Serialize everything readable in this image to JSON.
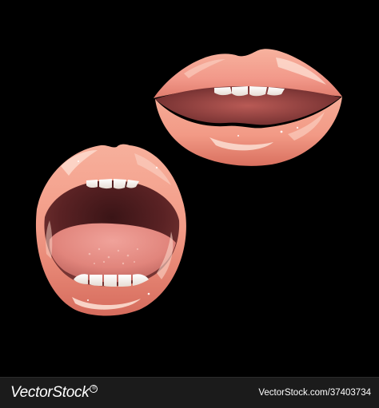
{
  "image": {
    "subjects": [
      "closed-smile-lips",
      "open-mouth-lips"
    ],
    "colors": {
      "background": "#000000",
      "lip": "#f29a86",
      "lip_dark": "#c85c50",
      "mouth_interior": "#5a2224",
      "tongue": "#e1857c",
      "teeth": "#f6f1ec",
      "footer": "#1b1b1b"
    }
  },
  "watermark": {
    "brand": "VectorStock",
    "registered_mark": "®",
    "image_id": "VectorStock.com/37403734"
  }
}
